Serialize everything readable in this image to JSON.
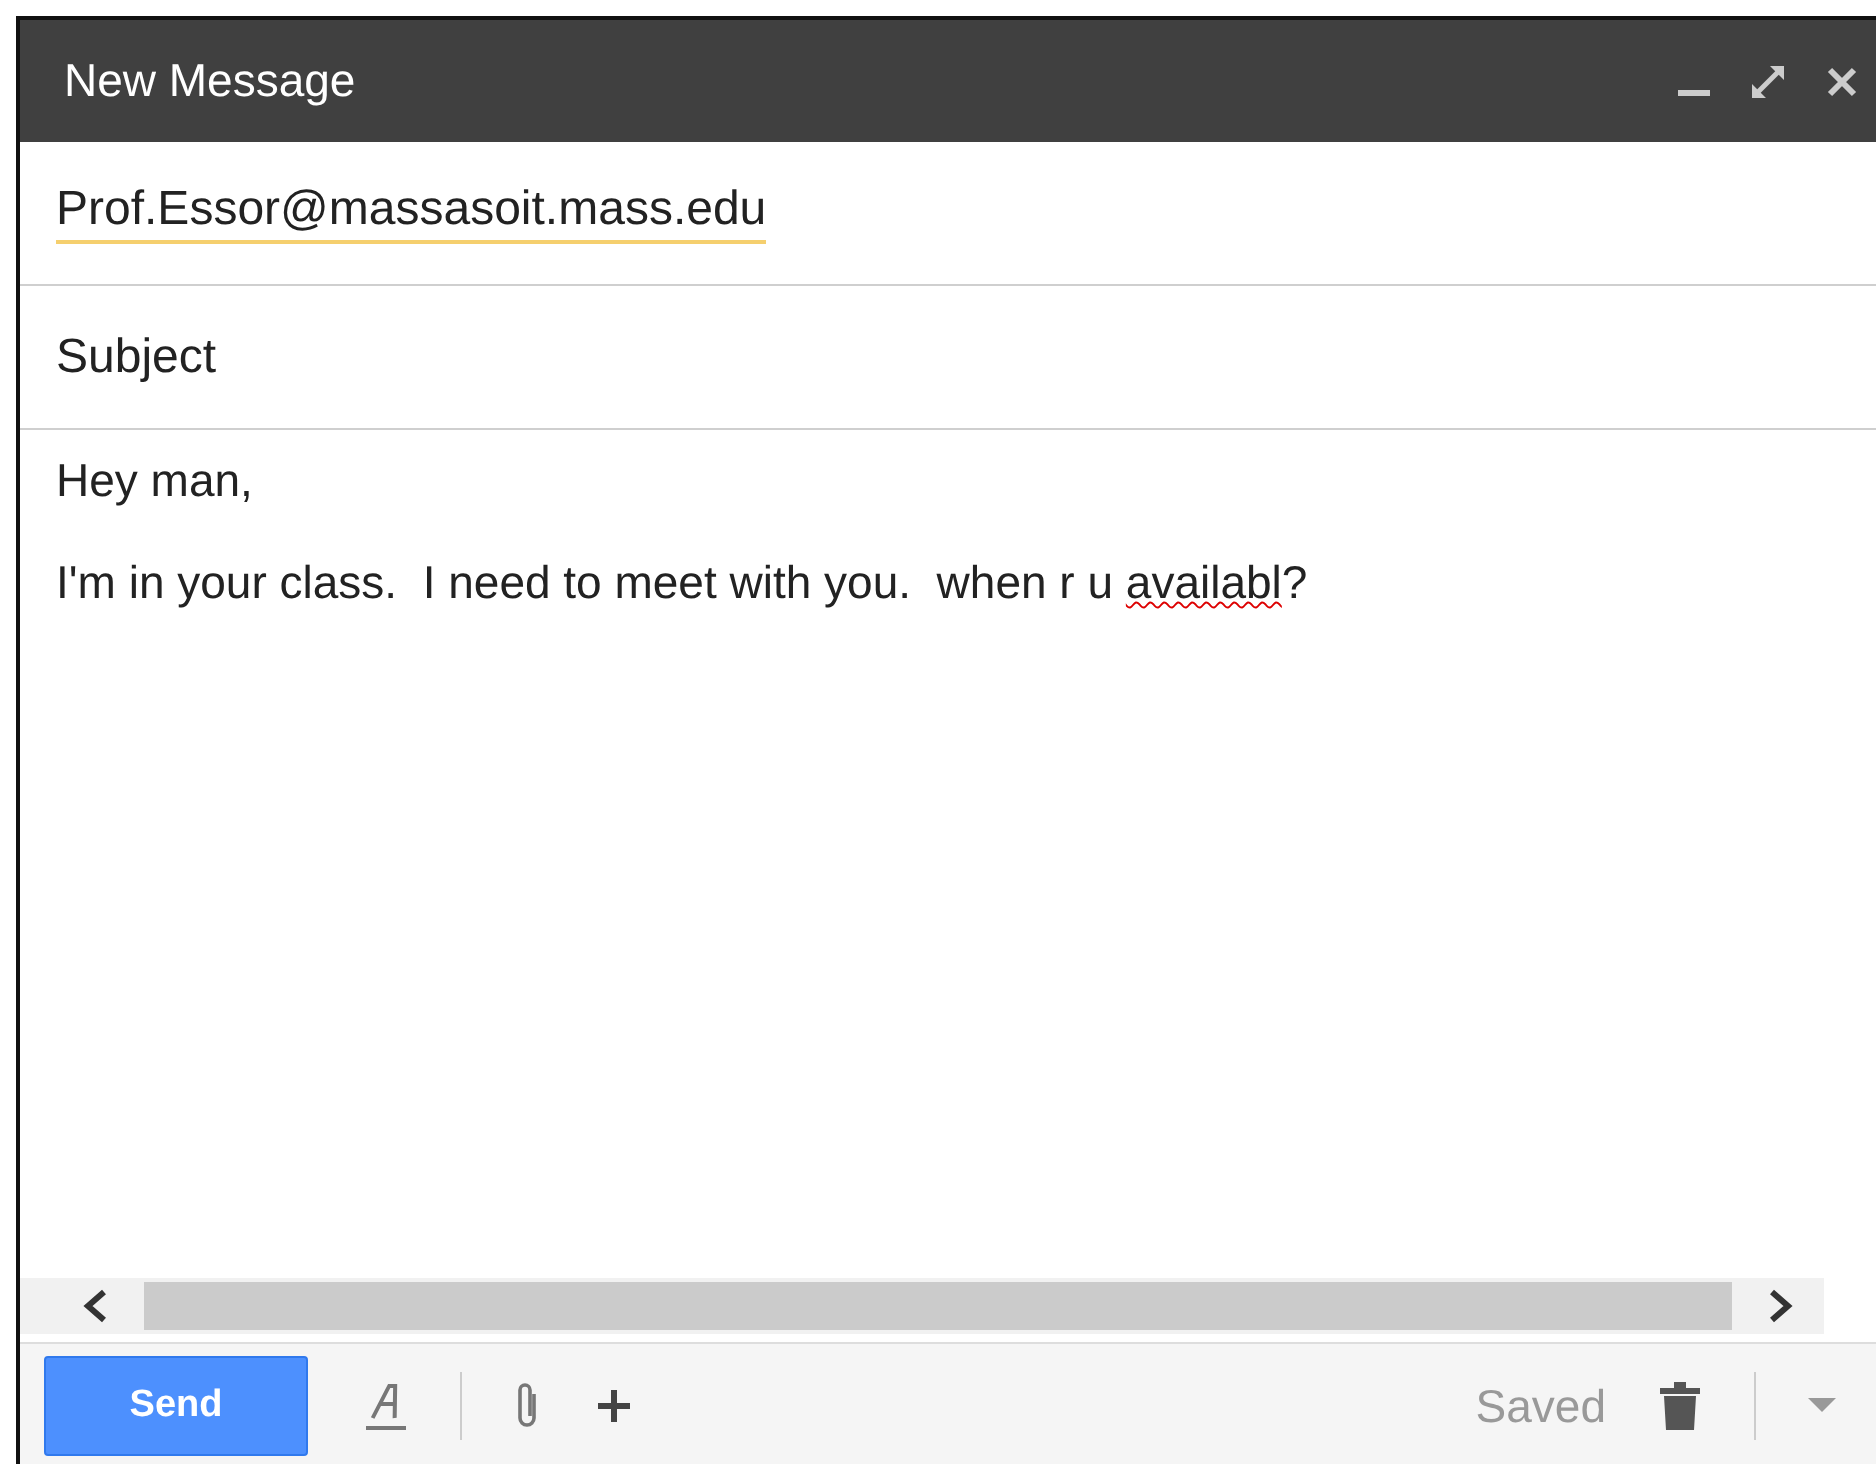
{
  "window": {
    "title": "New Message"
  },
  "to": {
    "value": "Prof.Essor@massasoit.mass.edu"
  },
  "subject": {
    "placeholder": "Subject"
  },
  "body": {
    "lines": [
      [
        {
          "text": "Hey man,",
          "misspelled": false
        }
      ],
      [
        {
          "text": "I'm in your class.  I need to meet with you.  when r u ",
          "misspelled": false
        },
        {
          "text": "availabl",
          "misspelled": true
        },
        {
          "text": "?",
          "misspelled": false
        }
      ]
    ]
  },
  "footer": {
    "send": "Send",
    "status": "Saved"
  }
}
